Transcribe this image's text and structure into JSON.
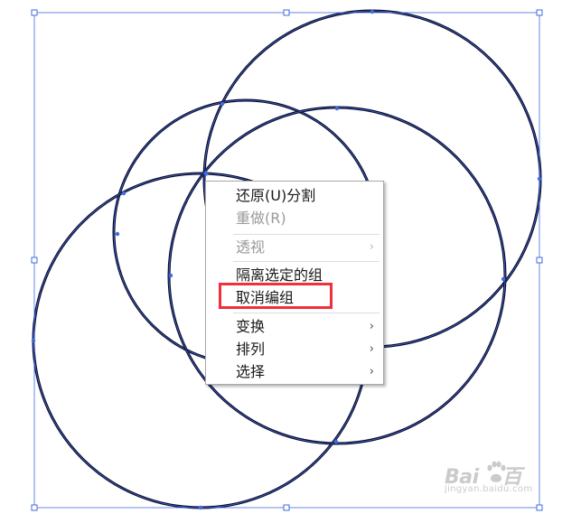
{
  "context_menu": {
    "items": [
      {
        "label": "还原(U)分割",
        "enabled": true,
        "submenu": false
      },
      {
        "label": "重做(R)",
        "enabled": false,
        "submenu": false
      },
      {
        "label": "透视",
        "enabled": false,
        "submenu": true
      },
      {
        "label": "隔离选定的组",
        "enabled": true,
        "submenu": false
      },
      {
        "label": "取消编组",
        "enabled": true,
        "submenu": false,
        "highlighted": true
      },
      {
        "label": "变换",
        "enabled": true,
        "submenu": true
      },
      {
        "label": "排列",
        "enabled": true,
        "submenu": true
      },
      {
        "label": "选择",
        "enabled": true,
        "submenu": true
      }
    ],
    "submenu_arrow_glyph": "›"
  },
  "watermark": {
    "brand_left": "Bai",
    "brand_right": "百",
    "site": "jingyan.baidu.com"
  },
  "colors": {
    "circle_stroke": "#0b0b24",
    "selection_blue": "#4169e1",
    "highlight_red": "#f0303a"
  }
}
